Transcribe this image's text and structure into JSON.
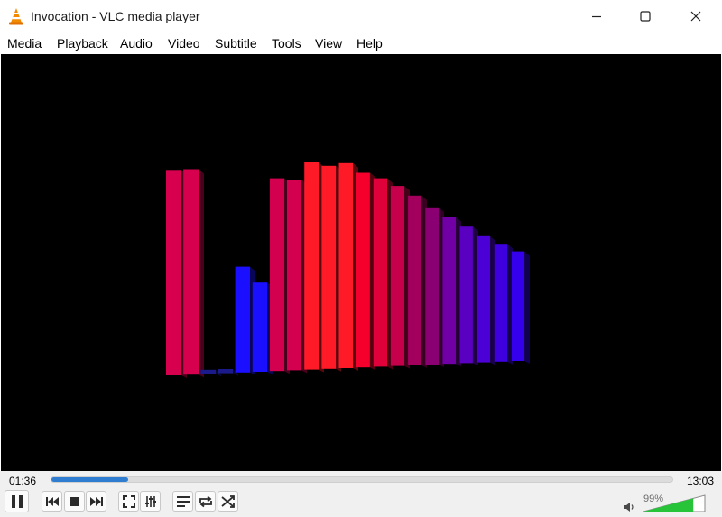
{
  "window": {
    "title": "Invocation - VLC media player",
    "icon": "vlc-cone-icon"
  },
  "menu": [
    {
      "label": "Media"
    },
    {
      "label": "Playback"
    },
    {
      "label": "Audio"
    },
    {
      "label": "Video"
    },
    {
      "label": "Subtitle"
    },
    {
      "label": "Tools"
    },
    {
      "label": "View"
    },
    {
      "label": "Help"
    }
  ],
  "visualizer": {
    "type": "3D spectrum bars",
    "bar_levels": [
      0.99,
      0.99,
      0.02,
      0.02,
      0.51,
      0.43,
      0.93,
      0.92,
      1.0,
      0.98,
      0.99,
      0.94,
      0.91,
      0.87,
      0.82,
      0.76,
      0.71,
      0.66,
      0.61,
      0.57,
      0.53
    ],
    "bar_colors": [
      "#d6004f",
      "#d6004f",
      "#1a1a8a",
      "#1a1a8a",
      "#1a10ff",
      "#1a10ff",
      "#d3004f",
      "#d3004f",
      "#ff1a28",
      "#ff1a28",
      "#ff1a28",
      "#f5002c",
      "#e0003a",
      "#c6004a",
      "#a3005e",
      "#8a0072",
      "#7000a6",
      "#5a00c0",
      "#4b00d6",
      "#3f00e0",
      "#3500ec"
    ]
  },
  "playback": {
    "elapsed": "01:36",
    "total": "13:03",
    "progress": 0.123
  },
  "controls": {
    "pause": "pause-icon",
    "previous": "previous-icon",
    "stop": "stop-icon",
    "next": "next-icon",
    "fullscreen": "fullscreen-icon",
    "extended": "extended-settings-icon",
    "playlist": "playlist-icon",
    "loop": "loop-icon",
    "shuffle": "shuffle-icon"
  },
  "volume": {
    "label": "99%",
    "level": 0.99
  }
}
